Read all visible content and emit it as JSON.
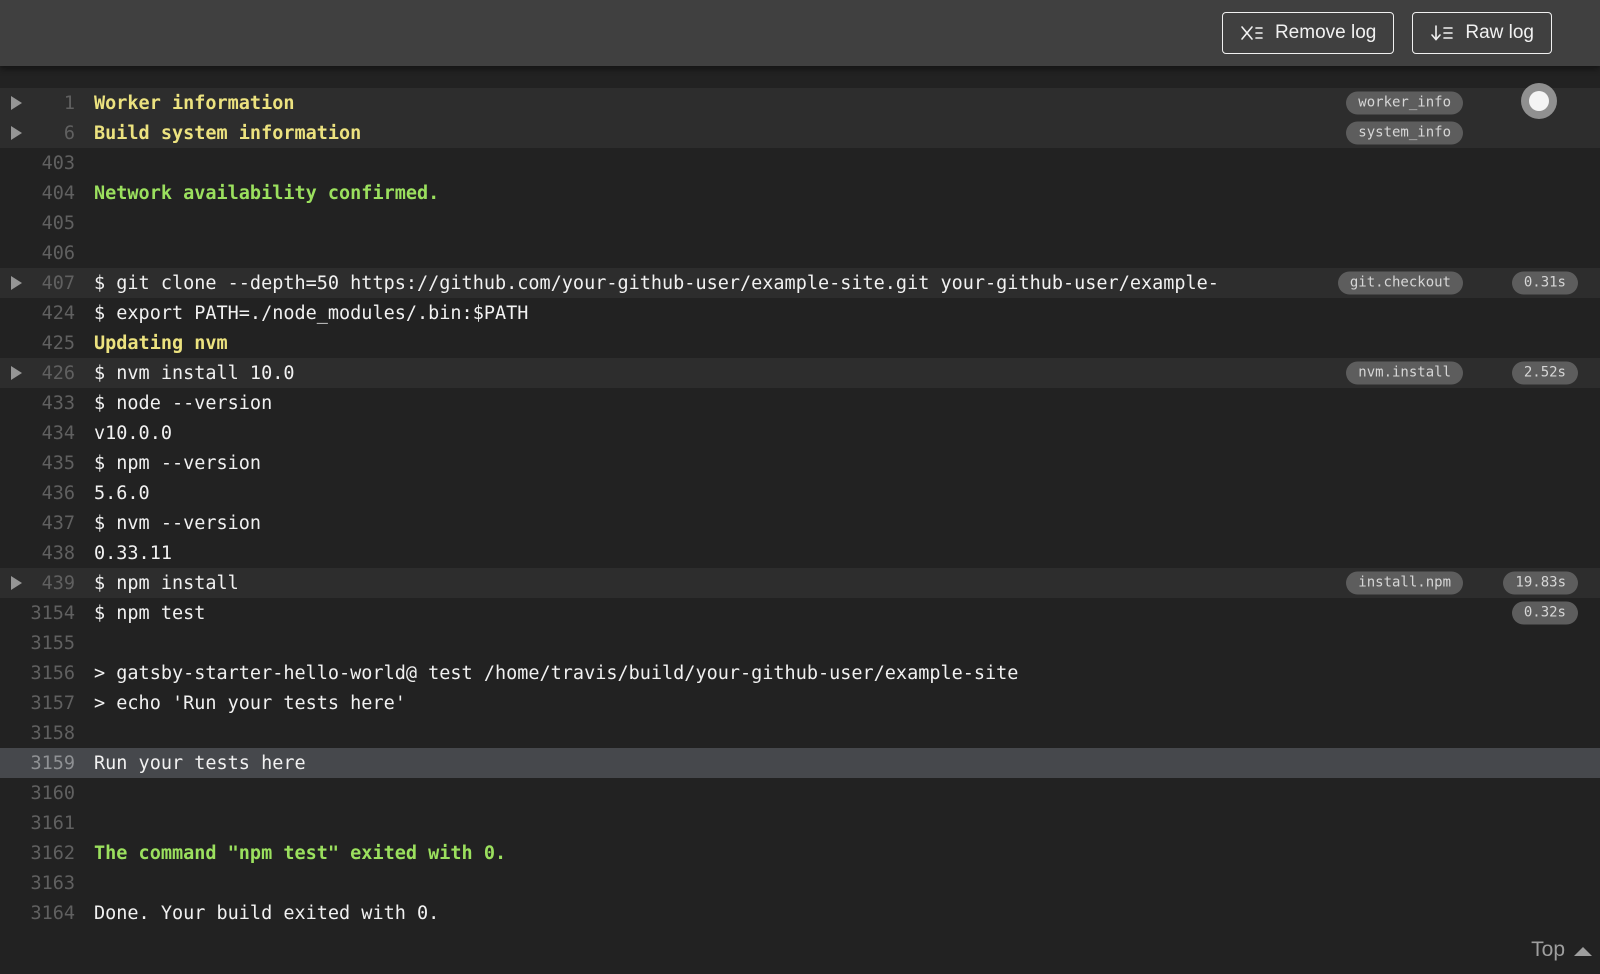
{
  "toolbar": {
    "remove_log_label": "Remove log",
    "raw_log_label": "Raw log"
  },
  "footer": {
    "top_label": "Top"
  },
  "colors": {
    "yellow": "#ece27f",
    "green": "#9be05e",
    "topbar_bg": "#404040",
    "log_bg": "#222222",
    "fold_row_bg": "#2d2d2d",
    "selected_row_bg": "#46484c",
    "badge_bg": "#5d5d5d"
  },
  "log": {
    "rows": [
      {
        "num": "1",
        "text": "Worker information",
        "color": "yellow",
        "fold": true,
        "tag": "worker_info"
      },
      {
        "num": "6",
        "text": "Build system information",
        "color": "yellow",
        "fold": true,
        "tag": "system_info"
      },
      {
        "num": "403",
        "text": ""
      },
      {
        "num": "404",
        "text": "Network availability confirmed.",
        "color": "green"
      },
      {
        "num": "405",
        "text": ""
      },
      {
        "num": "406",
        "text": ""
      },
      {
        "num": "407",
        "text": "$ git clone --depth=50 https://github.com/your-github-user/example-site.git your-github-user/example-",
        "fold": true,
        "tag": "git.checkout",
        "duration": "0.31s"
      },
      {
        "num": "424",
        "text": "$ export PATH=./node_modules/.bin:$PATH"
      },
      {
        "num": "425",
        "text": "Updating nvm",
        "color": "yellow"
      },
      {
        "num": "426",
        "text": "$ nvm install 10.0",
        "fold": true,
        "tag": "nvm.install",
        "duration": "2.52s"
      },
      {
        "num": "433",
        "text": "$ node --version"
      },
      {
        "num": "434",
        "text": "v10.0.0"
      },
      {
        "num": "435",
        "text": "$ npm --version"
      },
      {
        "num": "436",
        "text": "5.6.0"
      },
      {
        "num": "437",
        "text": "$ nvm --version"
      },
      {
        "num": "438",
        "text": "0.33.11"
      },
      {
        "num": "439",
        "text": "$ npm install",
        "fold": true,
        "tag": "install.npm",
        "duration": "19.83s"
      },
      {
        "num": "3154",
        "text": "$ npm test",
        "duration": "0.32s"
      },
      {
        "num": "3155",
        "text": ""
      },
      {
        "num": "3156",
        "text": "> gatsby-starter-hello-world@ test /home/travis/build/your-github-user/example-site"
      },
      {
        "num": "3157",
        "text": "> echo 'Run your tests here'"
      },
      {
        "num": "3158",
        "text": ""
      },
      {
        "num": "3159",
        "text": "Run your tests here",
        "selected": true
      },
      {
        "num": "3160",
        "text": ""
      },
      {
        "num": "3161",
        "text": ""
      },
      {
        "num": "3162",
        "text": "The command \"npm test\" exited with 0.",
        "color": "green"
      },
      {
        "num": "3163",
        "text": ""
      },
      {
        "num": "3164",
        "text": "Done. Your build exited with 0."
      }
    ]
  }
}
